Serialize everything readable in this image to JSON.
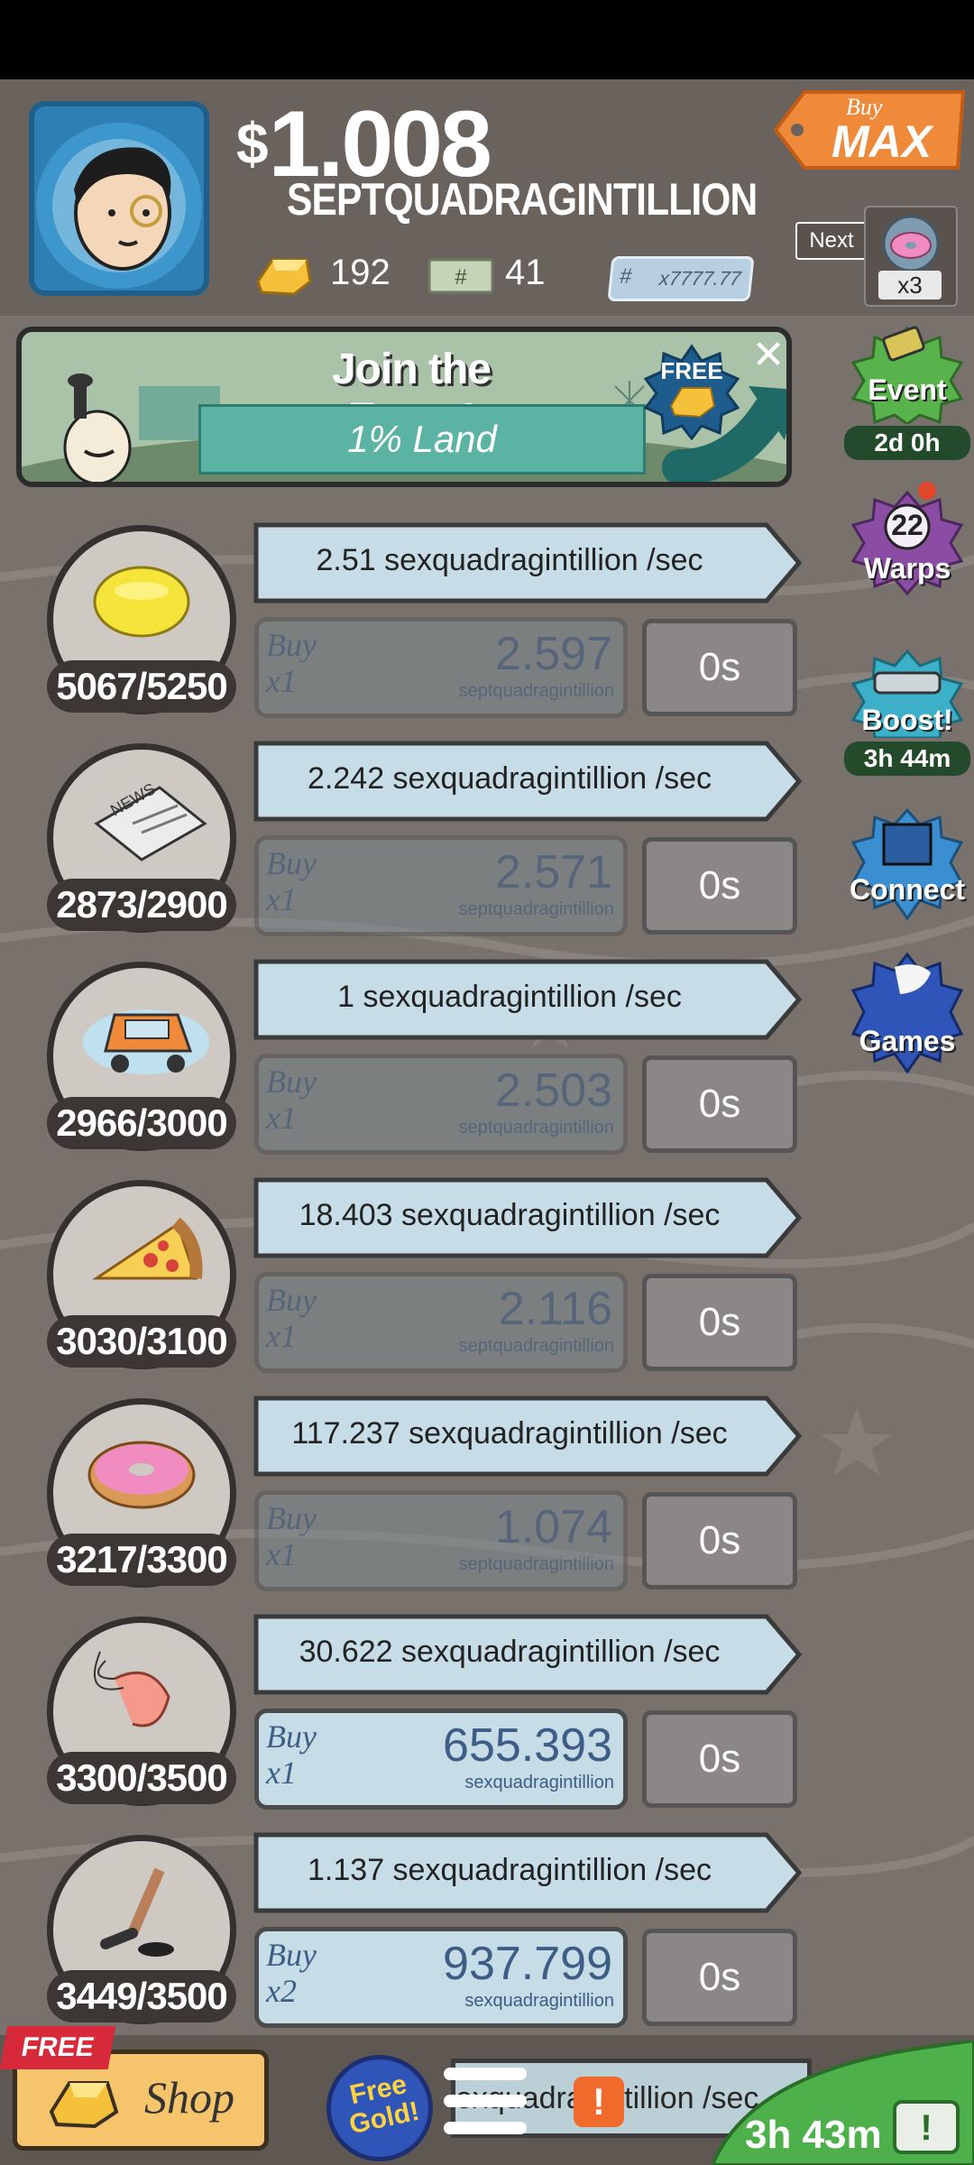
{
  "header": {
    "currency_symbol": "$",
    "money_amount": "1.008",
    "money_unit": "SEPTQUADRAGINTILLION",
    "gold": "192",
    "megabucks": "41",
    "bill_counter": "x7777.77",
    "buy_max": {
      "buy": "Buy",
      "max": "MAX"
    },
    "next_label": "Next",
    "next_multiplier": "x3"
  },
  "event": {
    "title": "Join the Event!",
    "subtitle": "1% Land",
    "free_badge": "FREE"
  },
  "side_buttons": [
    {
      "label": "Event",
      "time": "2d 0h"
    },
    {
      "label": "Warps",
      "count": "22"
    },
    {
      "label": "Boost!",
      "time": "3h 44m"
    },
    {
      "label": "Connect"
    },
    {
      "label": "Games"
    }
  ],
  "businesses": [
    {
      "name": "lemon",
      "owned": "5067/5250",
      "rate": "2.51 sexquadragintillion /sec",
      "buy_label": "Buy",
      "buy_mult": "x1",
      "cost": "2.597",
      "cost_unit": "septquadragintillion",
      "timer": "0s",
      "affordable": false
    },
    {
      "name": "newspaper",
      "owned": "2873/2900",
      "rate": "2.242 sexquadragintillion /sec",
      "buy_label": "Buy",
      "buy_mult": "x1",
      "cost": "2.571",
      "cost_unit": "septquadragintillion",
      "timer": "0s",
      "affordable": false
    },
    {
      "name": "car",
      "owned": "2966/3000",
      "rate": "1 sexquadragintillion /sec",
      "buy_label": "Buy",
      "buy_mult": "x1",
      "cost": "2.503",
      "cost_unit": "septquadragintillion",
      "timer": "0s",
      "affordable": false
    },
    {
      "name": "pizza",
      "owned": "3030/3100",
      "rate": "18.403 sexquadragintillion /sec",
      "buy_label": "Buy",
      "buy_mult": "x1",
      "cost": "2.116",
      "cost_unit": "septquadragintillion",
      "timer": "0s",
      "affordable": false
    },
    {
      "name": "donut",
      "owned": "3217/3300",
      "rate": "117.237 sexquadragintillion /sec",
      "buy_label": "Buy",
      "buy_mult": "x1",
      "cost": "1.074",
      "cost_unit": "septquadragintillion",
      "timer": "0s",
      "affordable": false
    },
    {
      "name": "shrimp",
      "owned": "3300/3500",
      "rate": "30.622 sexquadragintillion /sec",
      "buy_label": "Buy",
      "buy_mult": "x1",
      "cost": "655.393",
      "cost_unit": "sexquadragintillion",
      "timer": "0s",
      "affordable": true
    },
    {
      "name": "hockey",
      "owned": "3449/3500",
      "rate": "1.137 sexquadragintillion /sec",
      "buy_label": "Buy",
      "buy_mult": "x2",
      "cost": "937.799",
      "cost_unit": "sexquadragintillion",
      "timer": "0s",
      "affordable": true
    }
  ],
  "bottom": {
    "free_tag": "FREE",
    "shop_label": "Shop",
    "free_gold_line1": "Free",
    "free_gold_line2": "Gold!",
    "partial_rate": "exquadragintillion /sec",
    "alert": "!",
    "timer": "3h 43m"
  },
  "colors": {
    "background": "#79716c",
    "header": "#6a625d",
    "event_green": "#58b34c",
    "warps_purple": "#8b4ca3",
    "boost_teal": "#3cb0c8",
    "games_blue": "#2f55b8"
  }
}
